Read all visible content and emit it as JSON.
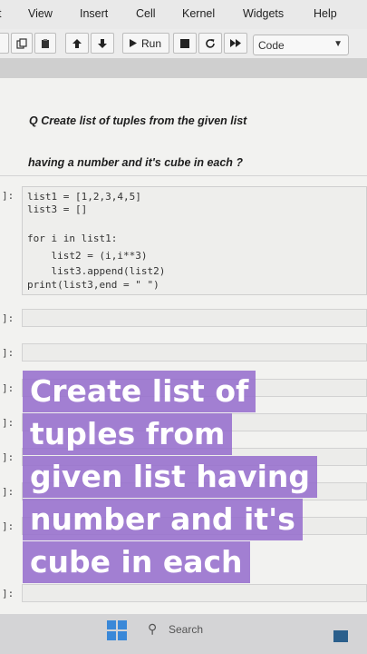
{
  "menu": {
    "items": [
      "t",
      "View",
      "Insert",
      "Cell",
      "Kernel",
      "Widgets",
      "Help"
    ]
  },
  "toolbar": {
    "run_label": "Run",
    "cell_type": "Code",
    "icons": [
      "copy-icon",
      "paste-icon",
      "move-up-icon",
      "move-down-icon",
      "run-icon",
      "stop-icon",
      "restart-icon",
      "fast-forward-icon"
    ]
  },
  "notebook": {
    "markdown": {
      "line1": "Q Create list of tuples from the given list",
      "line2": "having a number and it's cube in each ?"
    },
    "code_prompt": "]:",
    "code_lines": [
      "list1 = [1,2,3,4,5]",
      "list3 = []",
      "",
      "for i in list1:",
      "    list2 = (i,i**3)",
      "    list3.append(list2)",
      "print(list3,end = \" \")"
    ],
    "empty_prompts": [
      "]:",
      "]:",
      "]:",
      "]:",
      "]:",
      "]:",
      "]:",
      "]:"
    ]
  },
  "overlay": {
    "lines": [
      "Create list of",
      "tuples from",
      "given list having",
      "number and it's",
      "cube in each"
    ],
    "color": "#966ecd"
  },
  "taskbar": {
    "search_label": "Search"
  }
}
